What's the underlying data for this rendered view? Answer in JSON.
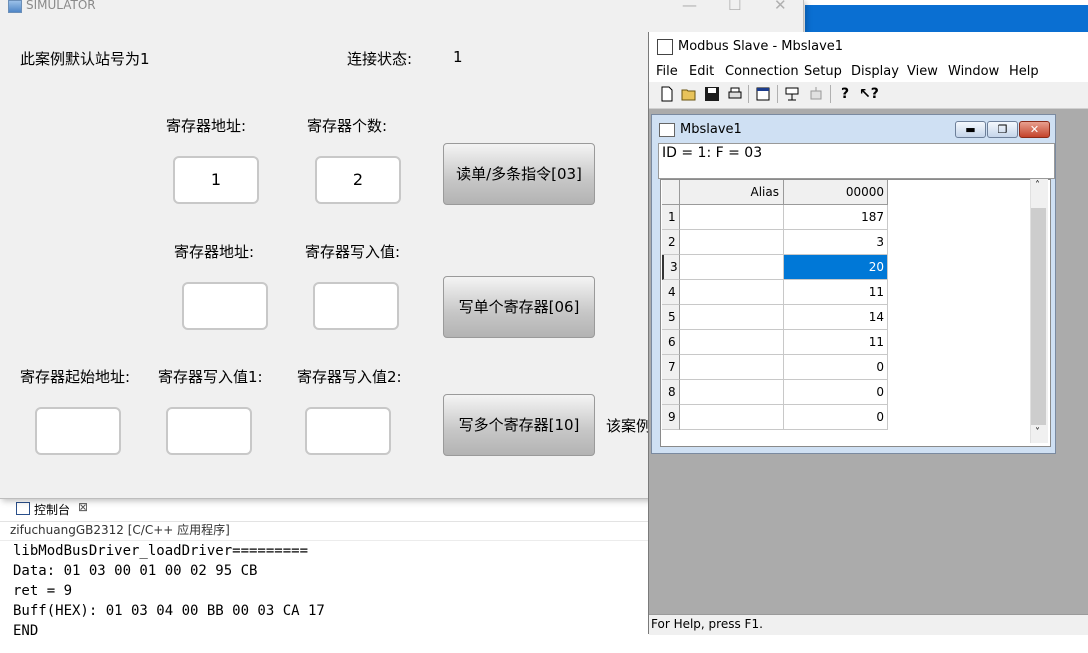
{
  "console": {
    "tab_label": "控制台",
    "close_glyph": "⊠",
    "subtitle": "zifuchuangGB2312 [C/C++ 应用程序]",
    "lines": [
      "libModBusDriver_loadDriver=========",
      "Data: 01 03 00 01 00 02 95 CB",
      "ret = 9",
      "Buff(HEX): 01 03 04 00 BB 00 03 CA 17",
      "END"
    ]
  },
  "simulator": {
    "title": "SIMULATOR",
    "minimize": "—",
    "maximize": "☐",
    "close": "✕",
    "default_station": "此案例默认站号为1",
    "conn_label": "连接状态:",
    "conn_value": "1",
    "read": {
      "addr_label": "寄存器地址:",
      "count_label": "寄存器个数:",
      "addr_value": "1",
      "count_value": "2",
      "button": "读单/多条指令[03]"
    },
    "write_single": {
      "addr_label": "寄存器地址:",
      "value_label": "寄存器写入值:",
      "addr_value": "",
      "value_value": "",
      "button": "写单个寄存器[06]"
    },
    "write_multi": {
      "start_label": "寄存器起始地址:",
      "value1_label": "寄存器写入值1:",
      "value2_label": "寄存器写入值2:",
      "start_value": "",
      "value1_value": "",
      "value2_value": "",
      "button": "写多个寄存器[10]",
      "trailing_text": "该案例"
    }
  },
  "modbus": {
    "title": "Modbus Slave - Mbslave1",
    "menu": [
      "File",
      "Edit",
      "Connection",
      "Setup",
      "Display",
      "View",
      "Window",
      "Help"
    ],
    "status": "For Help, press F1.",
    "child": {
      "title": "Mbslave1",
      "info": "ID = 1: F = 03",
      "columns": {
        "alias": "Alias",
        "value": "00000"
      },
      "rows": [
        {
          "index": "1",
          "alias": "",
          "value": "187"
        },
        {
          "index": "2",
          "alias": "",
          "value": "3"
        },
        {
          "index": "3",
          "alias": "",
          "value": "20"
        },
        {
          "index": "4",
          "alias": "",
          "value": "11"
        },
        {
          "index": "5",
          "alias": "",
          "value": "14"
        },
        {
          "index": "6",
          "alias": "",
          "value": "11"
        },
        {
          "index": "7",
          "alias": "",
          "value": "0"
        },
        {
          "index": "8",
          "alias": "",
          "value": "0"
        },
        {
          "index": "9",
          "alias": "",
          "value": "0"
        }
      ],
      "selected_row": "3",
      "selected_color": "#0078d7"
    }
  }
}
